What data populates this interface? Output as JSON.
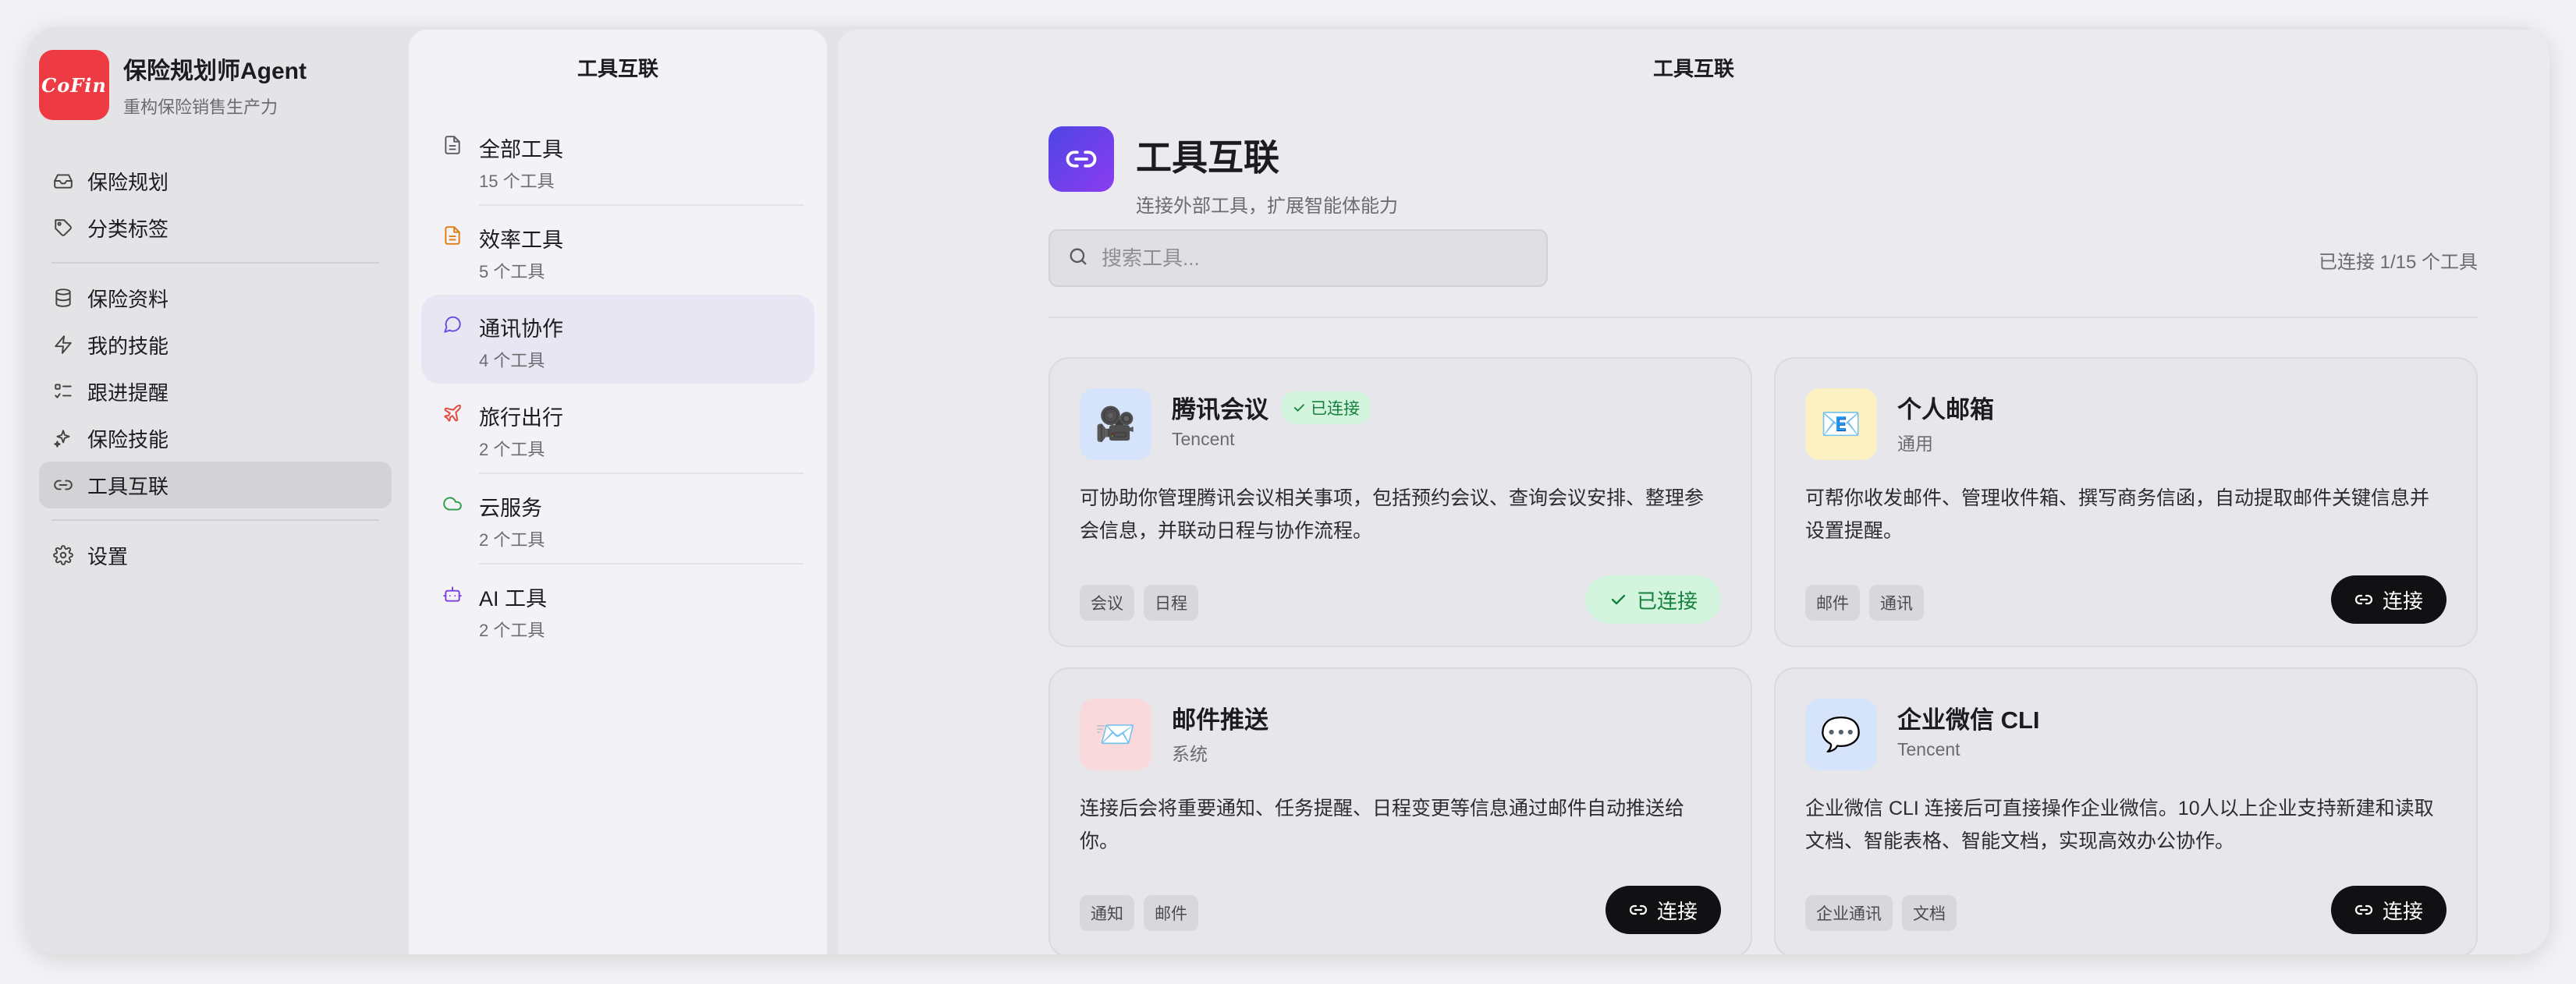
{
  "app": {
    "logo_text": "CoFin",
    "title": "保险规划师Agent",
    "subtitle": "重构保险销售生产力"
  },
  "nav": {
    "group1": [
      {
        "label": "保险规划",
        "icon": "inbox-icon"
      },
      {
        "label": "分类标签",
        "icon": "tag-icon"
      }
    ],
    "group2": [
      {
        "label": "保险资料",
        "icon": "database-icon"
      },
      {
        "label": "我的技能",
        "icon": "bolt-icon"
      },
      {
        "label": "跟进提醒",
        "icon": "checklist-icon"
      },
      {
        "label": "保险技能",
        "icon": "sparkle-icon"
      },
      {
        "label": "工具互联",
        "icon": "link-icon",
        "active": true
      }
    ],
    "group3": [
      {
        "label": "设置",
        "icon": "gear-icon"
      }
    ]
  },
  "category_panel": {
    "title": "工具互联",
    "items": [
      {
        "name": "全部工具",
        "count": "15 个工具",
        "icon": "document-icon",
        "color": "#5a5a60"
      },
      {
        "name": "效率工具",
        "count": "5 个工具",
        "icon": "document-icon",
        "color": "#e07b12"
      },
      {
        "name": "通讯协作",
        "count": "4 个工具",
        "icon": "chat-bubble-icon",
        "color": "#6d4ae6",
        "active": true
      },
      {
        "name": "旅行出行",
        "count": "2 个工具",
        "icon": "plane-icon",
        "color": "#e5483b"
      },
      {
        "name": "云服务",
        "count": "2 个工具",
        "icon": "cloud-icon",
        "color": "#2f9e4a"
      },
      {
        "name": "AI 工具",
        "count": "2 个工具",
        "icon": "robot-icon",
        "color": "#7b3fe4"
      }
    ]
  },
  "main": {
    "panel_title": "工具互联",
    "header_title": "工具互联",
    "header_subtitle": "连接外部工具，扩展智能体能力",
    "search_placeholder": "搜索工具...",
    "connected_status": "已连接 1/15 个工具",
    "accent_color": "#6d3cf0"
  },
  "tools": [
    {
      "name": "腾讯会议",
      "vendor": "Tencent",
      "badge": "已连接",
      "description": "可协助你管理腾讯会议相关事项，包括预约会议、查询会议安排、整理参会信息，并联动日程与协作流程。",
      "tags": [
        "会议",
        "日程"
      ],
      "button": "已连接",
      "connected": true,
      "emoji": "🎥",
      "icon_bg": "#d6e4fb"
    },
    {
      "name": "个人邮箱",
      "vendor": "通用",
      "badge": "",
      "description": "可帮你收发邮件、管理收件箱、撰写商务信函，自动提取邮件关键信息并设置提醒。",
      "tags": [
        "邮件",
        "通讯"
      ],
      "button": "连接",
      "connected": false,
      "emoji": "📧",
      "icon_bg": "#fbf0c2"
    },
    {
      "name": "邮件推送",
      "vendor": "系统",
      "badge": "",
      "description": "连接后会将重要通知、任务提醒、日程变更等信息通过邮件自动推送给你。",
      "tags": [
        "通知",
        "邮件"
      ],
      "button": "连接",
      "connected": false,
      "emoji": "📨",
      "icon_bg": "#f9d9dc"
    },
    {
      "name": "企业微信 CLI",
      "vendor": "Tencent",
      "badge": "",
      "description": "企业微信 CLI 连接后可直接操作企业微信。10人以上企业支持新建和读取文档、智能表格、智能文档，实现高效办公协作。",
      "tags": [
        "企业通讯",
        "文档"
      ],
      "button": "连接",
      "connected": false,
      "emoji": "💬",
      "icon_bg": "#d6e4fb"
    }
  ]
}
